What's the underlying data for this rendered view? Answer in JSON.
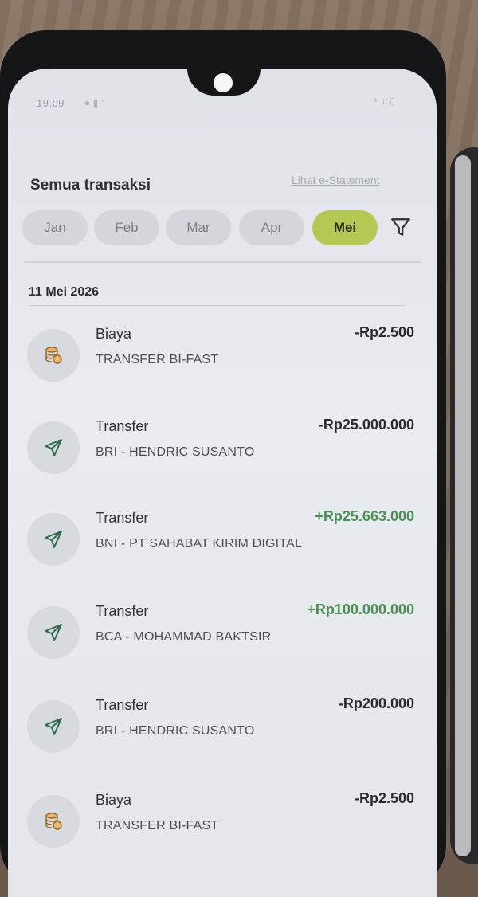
{
  "status_bar": {
    "time": "19.09"
  },
  "header": {
    "title": "Semua transaksi",
    "statement_link": "Lihat e-Statement"
  },
  "months": [
    {
      "label": "Jan",
      "active": false
    },
    {
      "label": "Feb",
      "active": false
    },
    {
      "label": "Mar",
      "active": false
    },
    {
      "label": "Apr",
      "active": false
    },
    {
      "label": "Mei",
      "active": true
    }
  ],
  "date_group": "11 Mei 2026",
  "transactions": [
    {
      "type": "Biaya",
      "description": "TRANSFER BI-FAST",
      "amount": "-Rp2.500",
      "icon": "coin-stack-icon",
      "positive": false
    },
    {
      "type": "Transfer",
      "description": "BRI - HENDRIC SUSANTO",
      "amount": "-Rp25.000.000",
      "icon": "send-icon",
      "positive": false
    },
    {
      "type": "Transfer",
      "description": "BNI - PT SAHABAT KIRIM DIGITAL",
      "amount": "+Rp25.663.000",
      "icon": "send-icon",
      "positive": true
    },
    {
      "type": "Transfer",
      "description": "BCA - MOHAMMAD BAKTSIR",
      "amount": "+Rp100.000.000",
      "icon": "send-icon",
      "positive": true
    },
    {
      "type": "Transfer",
      "description": "BRI - HENDRIC SUSANTO",
      "amount": "-Rp200.000",
      "icon": "send-icon",
      "positive": false
    },
    {
      "type": "Biaya",
      "description": "TRANSFER BI-FAST",
      "amount": "-Rp2.500",
      "icon": "coin-stack-icon",
      "positive": false
    }
  ],
  "colors": {
    "active_chip": "#b3c954",
    "positive_amount": "#4c8f53",
    "negative_amount": "#2a2d30"
  }
}
